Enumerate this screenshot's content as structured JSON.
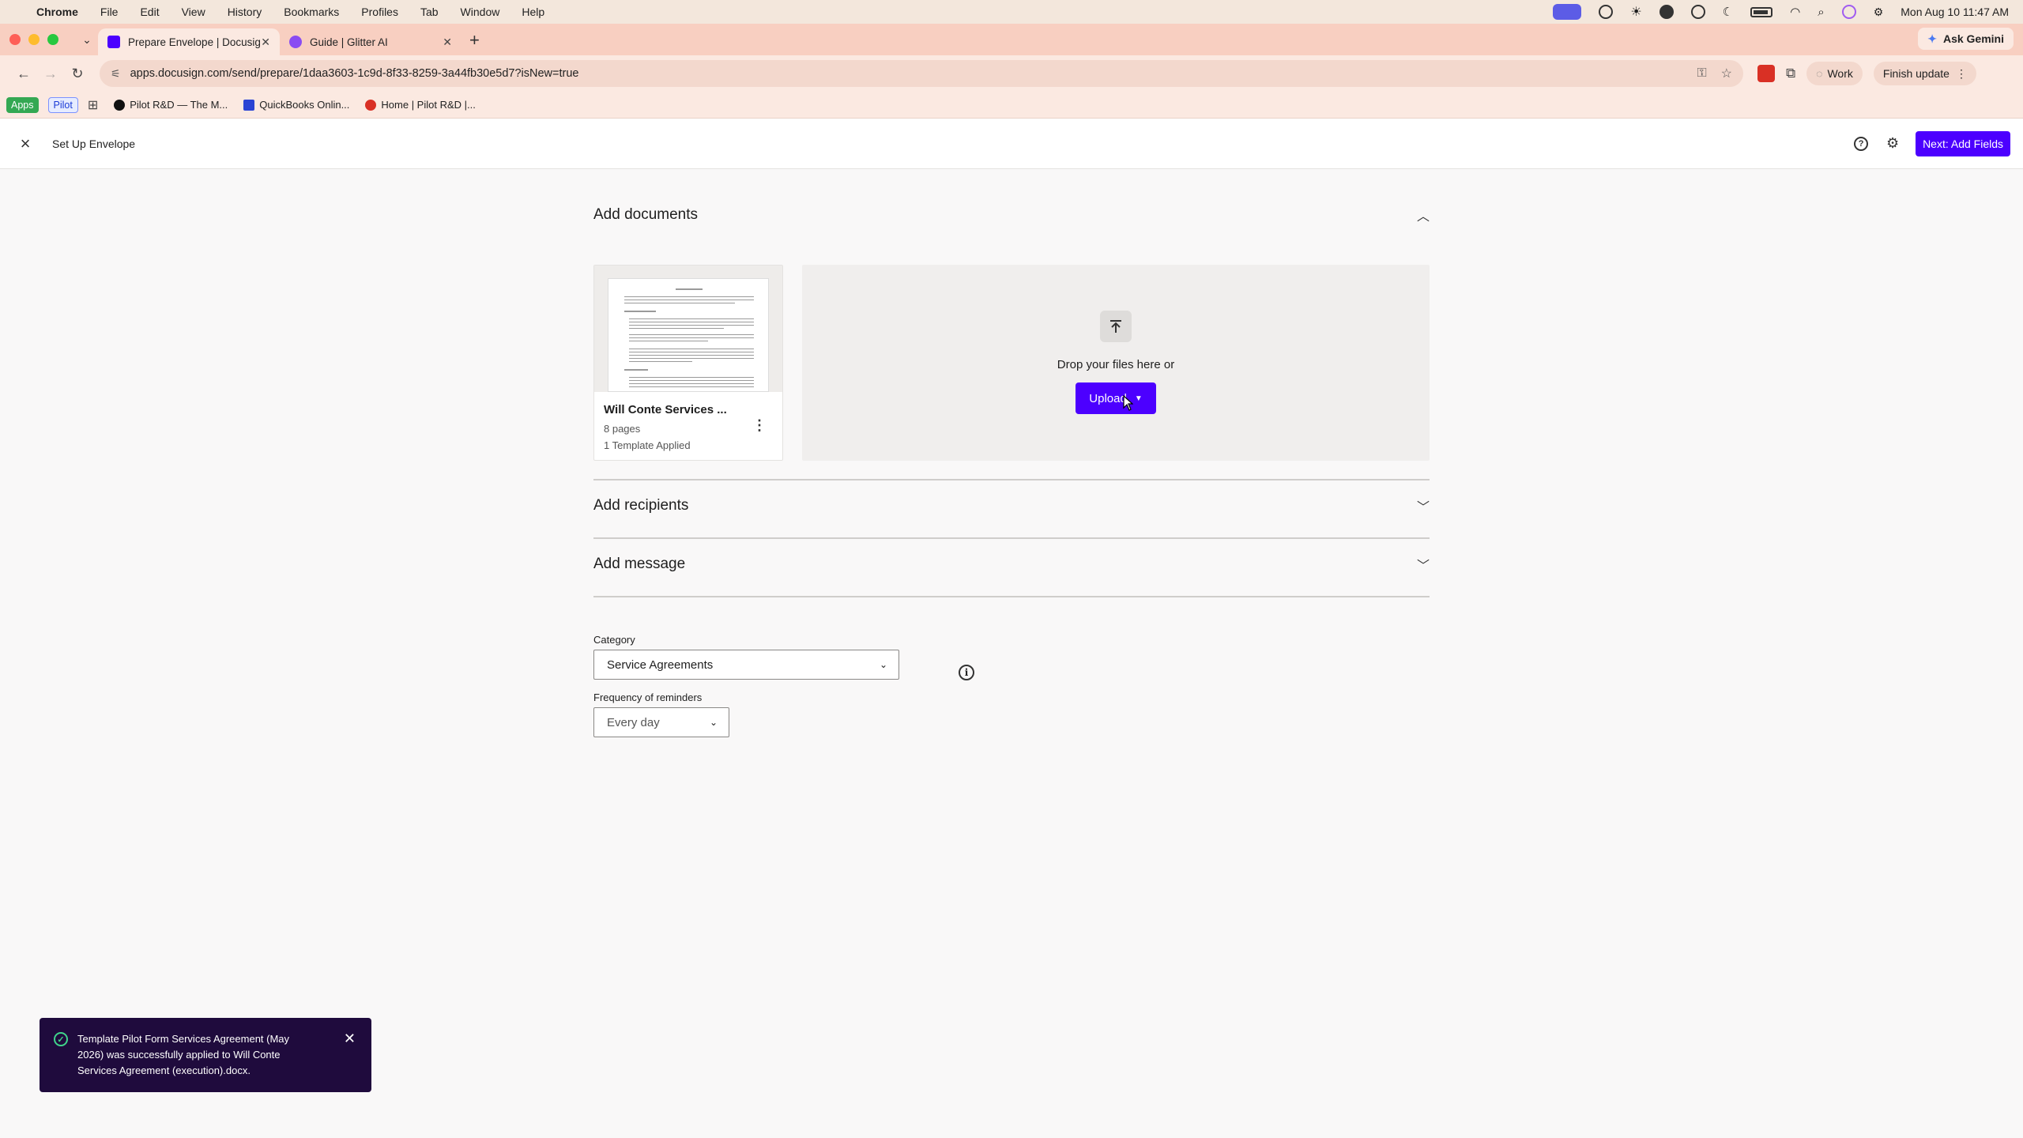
{
  "menubar": {
    "app": "Chrome",
    "items": [
      "File",
      "Edit",
      "View",
      "History",
      "Bookmarks",
      "Profiles",
      "Tab",
      "Window",
      "Help"
    ],
    "datetime": "Mon Aug 10  11:47 AM"
  },
  "tabs": [
    {
      "title": "Prepare Envelope | Docusign",
      "favicon_color": "#4c00ff",
      "active": true
    },
    {
      "title": "Guide | Glitter AI",
      "favicon_color": "#8a4cf2",
      "active": false
    }
  ],
  "ask_gemini": "Ask Gemini",
  "toolbar": {
    "url": "apps.docusign.com/send/prepare/1daa3603-1c9d-8f33-8259-3a44fb30e5d7?isNew=true",
    "profile": "Work",
    "finish_update": "Finish update"
  },
  "bookmarks": {
    "apps": "Apps",
    "pilot": "Pilot",
    "items": [
      "Pilot R&D — The M...",
      "QuickBooks Onlin...",
      "Home | Pilot R&D |..."
    ]
  },
  "header": {
    "title": "Set Up Envelope",
    "next_label": "Next: Add Fields"
  },
  "documents": {
    "section_title": "Add documents",
    "doc": {
      "name": "Will Conte Services ...",
      "pages": "8 pages",
      "template": "1 Template Applied"
    },
    "drop_text": "Drop your files here or",
    "upload_label": "Upload"
  },
  "recipients": {
    "section_title": "Add recipients"
  },
  "message": {
    "section_title": "Add message"
  },
  "category": {
    "label": "Category",
    "value": "Service Agreements"
  },
  "reminders": {
    "label": "Frequency of reminders",
    "value": "Every day"
  },
  "toast": {
    "message": "Template Pilot Form Services Agreement (May 2026) was successfully applied to Will Conte Services Agreement (execution).docx."
  },
  "colors": {
    "accent": "#4c00ff",
    "toast_bg": "#1f0b3d",
    "success": "#3fd48b"
  }
}
